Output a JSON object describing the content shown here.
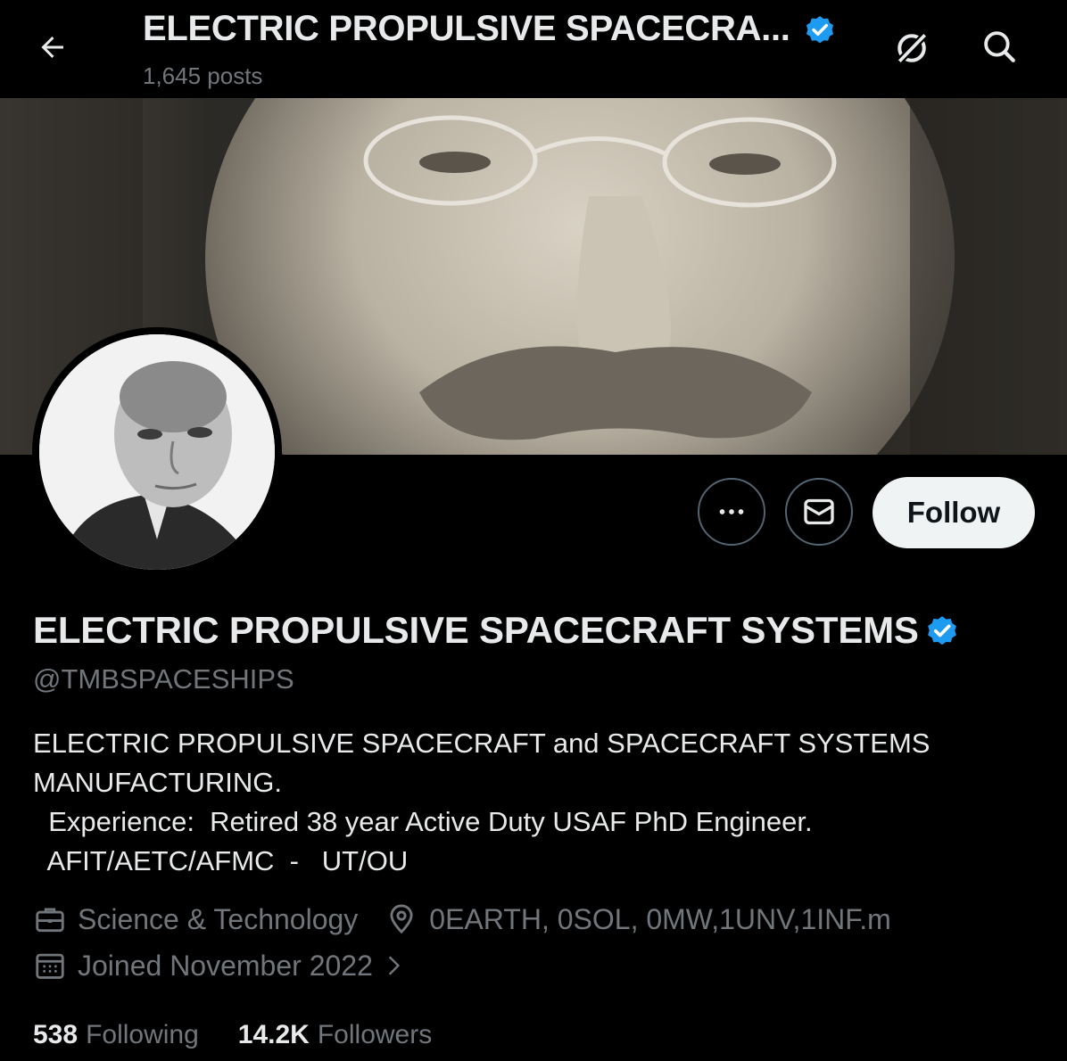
{
  "header": {
    "title": "ELECTRIC PROPULSIVE SPACECRA...",
    "post_count": "1,645 posts",
    "back_icon": "arrow-left-icon",
    "grok_icon": "grok-icon",
    "search_icon": "search-icon"
  },
  "profile": {
    "display_name": "ELECTRIC PROPULSIVE SPACECRAFT SYSTEMS",
    "handle": "@TMBSPACESHIPS",
    "verified": true,
    "badge_color": "#1d9bf0",
    "bio_lines": [
      "ELECTRIC PROPULSIVE SPACECRAFT and SPACECRAFT SYSTEMS",
      "MANUFACTURING.",
      "  Experience:  Retired 38 year Active Duty USAF PhD Engineer.",
      "  AFIT/AETC/AFMC  -   UT/OU"
    ],
    "category": "Science & Technology",
    "location": "0EARTH, 0SOL, 0MW,1UNV,1INF.m",
    "joined": "Joined November 2022"
  },
  "actions": {
    "more_icon": "more-dots-icon",
    "message_icon": "envelope-icon",
    "follow_label": "Follow"
  },
  "stats": {
    "following_count": "538",
    "following_label": "Following",
    "followers_count": "14.2K",
    "followers_label": "Followers"
  }
}
